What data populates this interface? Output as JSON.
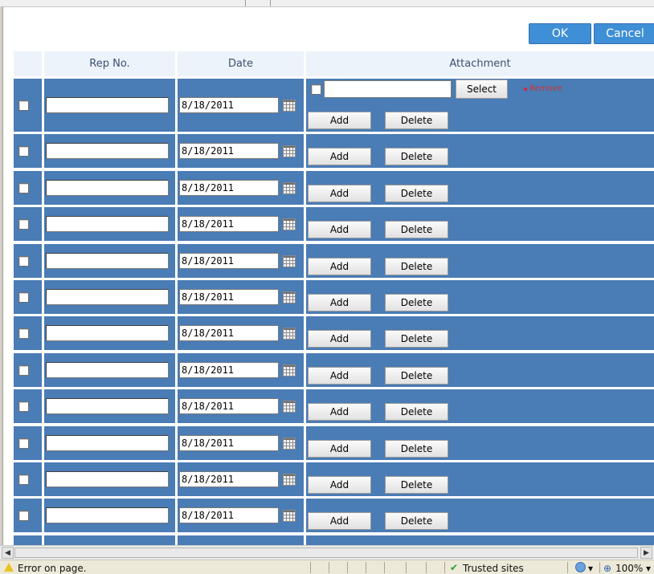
{
  "actions": {
    "ok_label": "OK",
    "cancel_label": "Cancel"
  },
  "grid": {
    "columns": [
      "",
      "Rep No.",
      "Date",
      "Attachment"
    ],
    "rows": [
      {
        "date": "8/18/2011"
      },
      {
        "date": "8/18/2011"
      },
      {
        "date": "8/18/2011"
      },
      {
        "date": "8/18/2011"
      },
      {
        "date": "8/18/2011"
      },
      {
        "date": "8/18/2011"
      },
      {
        "date": "8/18/2011"
      },
      {
        "date": "8/18/2011"
      },
      {
        "date": "8/18/2011"
      },
      {
        "date": "8/18/2011"
      },
      {
        "date": "8/18/2011"
      },
      {
        "date": "8/18/2011"
      }
    ],
    "attachment": {
      "select_label": "Select",
      "remove_label": "Remove",
      "add_label": "Add",
      "delete_label": "Delete"
    }
  },
  "statusbar": {
    "message": "Error on page.",
    "zone": "Trusted sites",
    "zoom": "100%"
  },
  "icons": {
    "warning": "warning-icon",
    "calendar": "calendar-icon",
    "trusted": "check-icon",
    "zoom": "zoom-icon"
  },
  "colors": {
    "row_bg": "#4a7cb5",
    "header_bg": "#edf3fa",
    "button_bg": "#3f8fd6"
  }
}
